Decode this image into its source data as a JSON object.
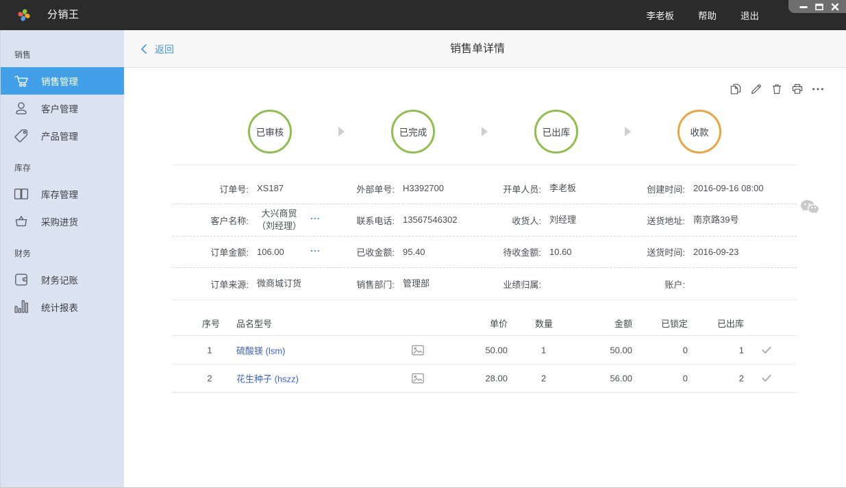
{
  "topbar": {
    "app_title": "分销王",
    "user": "李老板",
    "help": "帮助",
    "logout": "退出"
  },
  "window_controls": [
    "minimize",
    "maximize",
    "close"
  ],
  "sidebar": {
    "sections": [
      {
        "label": "销售",
        "items": [
          {
            "label": "销售管理",
            "icon": "cart-icon",
            "active": true
          },
          {
            "label": "客户管理",
            "icon": "user-icon",
            "active": false
          },
          {
            "label": "产品管理",
            "icon": "tag-icon",
            "active": false
          }
        ]
      },
      {
        "label": "库存",
        "items": [
          {
            "label": "库存管理",
            "icon": "book-icon",
            "active": false
          },
          {
            "label": "采购进货",
            "icon": "basket-icon",
            "active": false
          }
        ]
      },
      {
        "label": "财务",
        "items": [
          {
            "label": "财务记账",
            "icon": "wallet-icon",
            "active": false
          },
          {
            "label": "统计报表",
            "icon": "bar-chart-icon",
            "active": false
          }
        ]
      }
    ]
  },
  "page": {
    "back_label": "返回",
    "title": "销售单详情"
  },
  "toolbar_icons": [
    "copy",
    "edit",
    "delete",
    "print",
    "more"
  ],
  "steps": [
    {
      "label": "已审核",
      "state": "done"
    },
    {
      "label": "已完成",
      "state": "done"
    },
    {
      "label": "已出库",
      "state": "done"
    },
    {
      "label": "收款",
      "state": "pending"
    }
  ],
  "order": {
    "rows": [
      [
        {
          "label": "订单号:",
          "value": "XS187"
        },
        {
          "label": "外部单号:",
          "value": "H3392700"
        },
        {
          "label": "开单人员:",
          "value": "李老板"
        },
        {
          "label": "创建时间:",
          "value": "2016-09-16 08:00"
        }
      ],
      [
        {
          "label": "客户名称:",
          "value": "大兴商贸",
          "value2": "（刘经理）",
          "more": "..."
        },
        {
          "label": "联系电话:",
          "value": "13567546302"
        },
        {
          "label": "收货人:",
          "value": "刘经理"
        },
        {
          "label": "送货地址:",
          "value": "南京路39号"
        }
      ],
      [
        {
          "label": "订单金额:",
          "value": "106.00",
          "more": "..."
        },
        {
          "label": "已收金额:",
          "value": "95.40"
        },
        {
          "label": "待收金额:",
          "value": "10.60"
        },
        {
          "label": "送货时间:",
          "value": "2016-09-23"
        }
      ],
      [
        {
          "label": "订单来源:",
          "value": "微商城订货"
        },
        {
          "label": "销售部门:",
          "value": "管理部"
        },
        {
          "label": "业绩归属:",
          "value": ""
        },
        {
          "label": "账户:",
          "value": ""
        }
      ]
    ]
  },
  "items_table": {
    "headers": {
      "no": "序号",
      "name": "品名型号",
      "price": "单价",
      "qty": "数量",
      "amount": "金额",
      "locked": "已锁定",
      "shipped": "已出库"
    },
    "rows": [
      {
        "no": "1",
        "name": "硫酸镁 (lsm)",
        "price": "50.00",
        "qty": "1",
        "amount": "50.00",
        "locked": "0",
        "shipped": "1"
      },
      {
        "no": "2",
        "name": "花生种子 (hszz)",
        "price": "28.00",
        "qty": "2",
        "amount": "56.00",
        "locked": "0",
        "shipped": "2"
      }
    ]
  },
  "colors": {
    "topbar_bg": "#2b2b2b",
    "sidebar_bg": "#dce3f0",
    "active_item_blue": "#41a0e8",
    "link_blue": "#4694dc",
    "product_link_blue": "#3b62d2",
    "step_done_green": "#8fbe4b",
    "step_pending_orange": "#eca440"
  }
}
